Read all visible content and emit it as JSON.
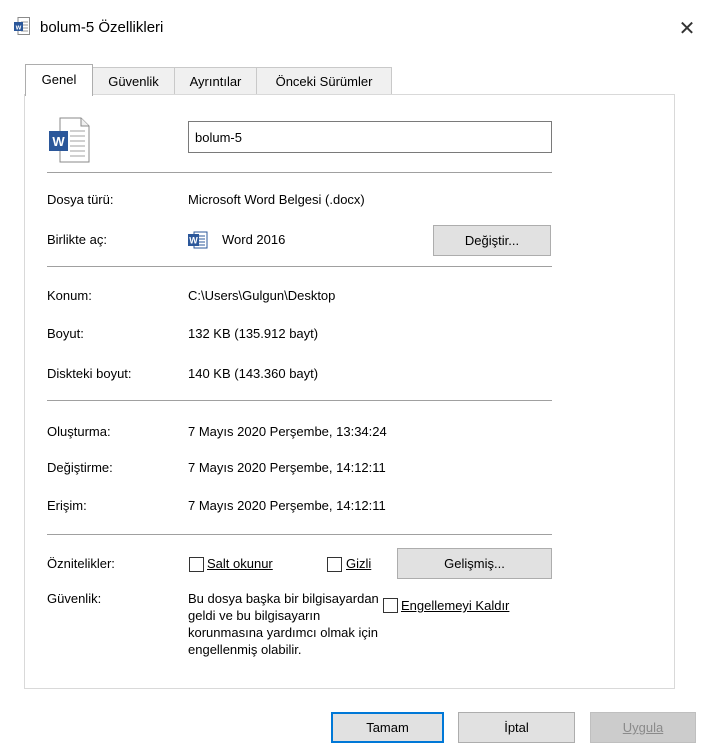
{
  "window": {
    "title": "bolum-5 Özellikleri",
    "close_label": "✕",
    "icon": "word-document-icon"
  },
  "tabs": [
    {
      "label": "Genel",
      "active": true
    },
    {
      "label": "Güvenlik",
      "active": false
    },
    {
      "label": "Ayrıntılar",
      "active": false
    },
    {
      "label": "Önceki Sürümler",
      "active": false
    }
  ],
  "general": {
    "file_icon": "word-document-large-icon",
    "file_name": "bolum-5",
    "file_type_label": "Dosya türü:",
    "file_type_value": "Microsoft Word Belgesi (.docx)",
    "opens_with_label": "Birlikte aç:",
    "opens_with_app": "Word 2016",
    "change_button": {
      "prefix": "De",
      "mnemonic": "ğ",
      "suffix": "iştir..."
    },
    "location_label": "Konum:",
    "location_value": "C:\\Users\\Gulgun\\Desktop",
    "size_label": "Boyut:",
    "size_value": "132 KB (135.912 bayt)",
    "size_on_disk_label": "Diskteki boyut:",
    "size_on_disk_value": "140 KB (143.360 bayt)",
    "created_label": "Oluşturma:",
    "created_value": "7 Mayıs 2020 Perşembe, 13:34:24",
    "modified_label": "Değiştirme:",
    "modified_value": "7 Mayıs 2020 Perşembe, 14:12:11",
    "accessed_label": "Erişim:",
    "accessed_value": "7 Mayıs 2020 Perşembe, 14:12:11",
    "attributes_label": "Öznitelikler:",
    "readonly_label": "Salt okunur",
    "readonly_checked": false,
    "hidden_label": "Gizli",
    "hidden_checked": false,
    "advanced_button": "Gelişmiş...",
    "security_label": "Güvenlik:",
    "security_text": "Bu dosya başka bir bilgisayardan geldi ve bu bilgisayarın korunmasına yardımcı olmak için engellenmiş olabilir.",
    "unblock_label": "Engellemeyi Kaldır",
    "unblock_checked": false
  },
  "footer": {
    "ok_label": "Tamam",
    "cancel_label": "İptal",
    "apply_label": "Uygula"
  },
  "colors": {
    "accent": "#0078d7",
    "word_blue": "#2b579a"
  }
}
